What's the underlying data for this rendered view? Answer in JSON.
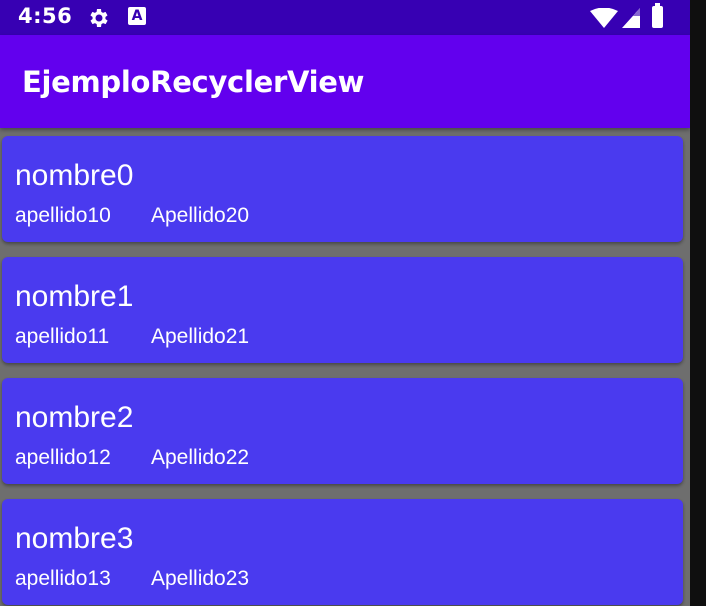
{
  "status_bar": {
    "time": "4:56",
    "icons": [
      "gear-icon",
      "a-notification-icon",
      "wifi-icon",
      "signal-icon",
      "battery-icon"
    ],
    "notification_letter": "A"
  },
  "app_bar": {
    "title": "EjemploRecyclerView"
  },
  "colors": {
    "status_bar": "#3700b3",
    "app_bar": "#6200ee",
    "card": "#4a3aef",
    "background": "#6e6e6e"
  },
  "list": {
    "items": [
      {
        "nombre": "nombre0",
        "apellido1": "apellido10",
        "apellido2": "Apellido20"
      },
      {
        "nombre": "nombre1",
        "apellido1": "apellido11",
        "apellido2": "Apellido21"
      },
      {
        "nombre": "nombre2",
        "apellido1": "apellido12",
        "apellido2": "Apellido22"
      },
      {
        "nombre": "nombre3",
        "apellido1": "apellido13",
        "apellido2": "Apellido23"
      }
    ]
  }
}
